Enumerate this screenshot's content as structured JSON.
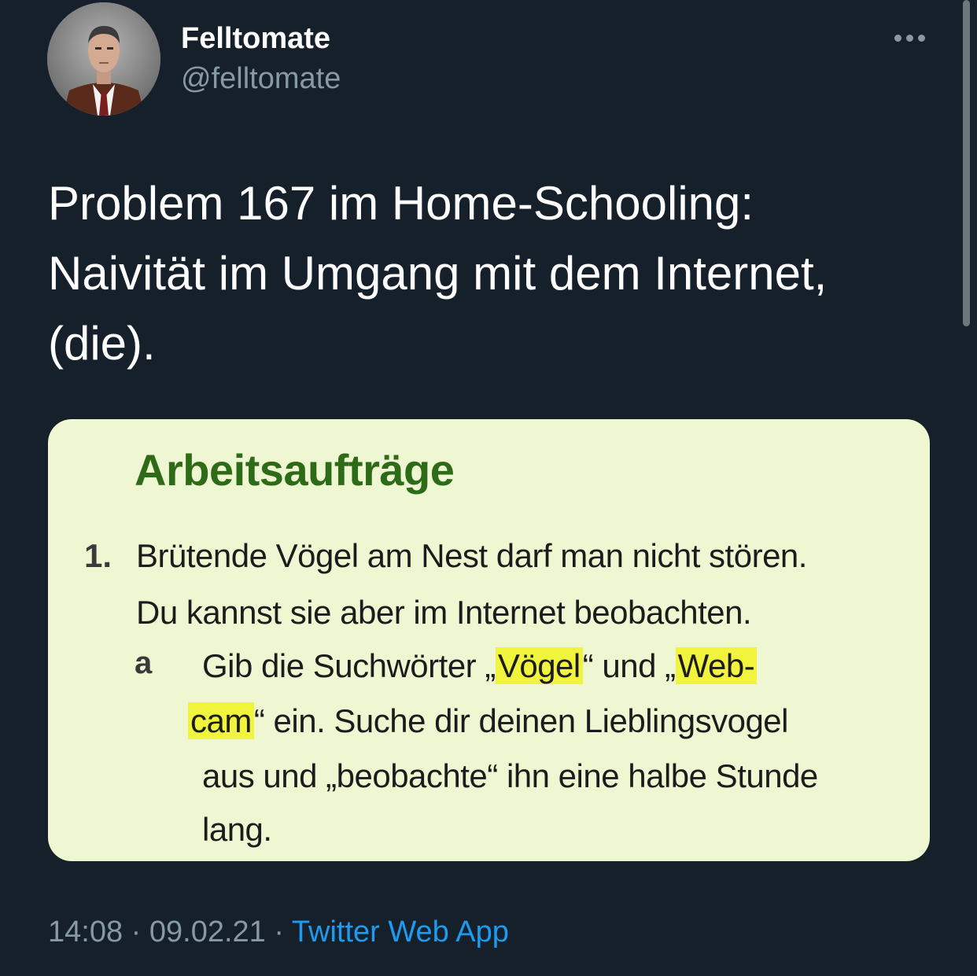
{
  "user": {
    "name": "Felltomate",
    "handle": "@felltomate"
  },
  "tweet": {
    "lines": [
      "Problem 167 im Home-Schooling:",
      "Naivität im Umgang mit dem Internet,",
      "(die)."
    ]
  },
  "media": {
    "heading": "Arbeitsaufträge",
    "number": "1.",
    "line1": "Brütende Vögel am Nest darf man nicht stören.",
    "line2": "Du kannst sie aber im Internet beobachten.",
    "letter": "a",
    "line3_before": "Gib die Suchwörter „",
    "line3_hl1": "Vögel",
    "line3_middle": "“ und „",
    "line3_hl2": "Web-",
    "line4_hl": "cam",
    "line4_after": "“ ein. Suche dir deinen Lieblingsvogel",
    "line5": "aus und „beobachte“ ihn eine halbe Stunde",
    "line6": "lang."
  },
  "meta": {
    "time": "14:08",
    "separator1": " · ",
    "date": "09.02.21",
    "separator2": " · ",
    "source": "Twitter Web App"
  },
  "colors": {
    "background": "#15202b",
    "secondary_text": "#8899a6",
    "link": "#1d9bf0",
    "highlight": "#f1f43c",
    "heading_green": "#2e6b18"
  },
  "icons": {
    "more": "more-horizontal-icon"
  }
}
